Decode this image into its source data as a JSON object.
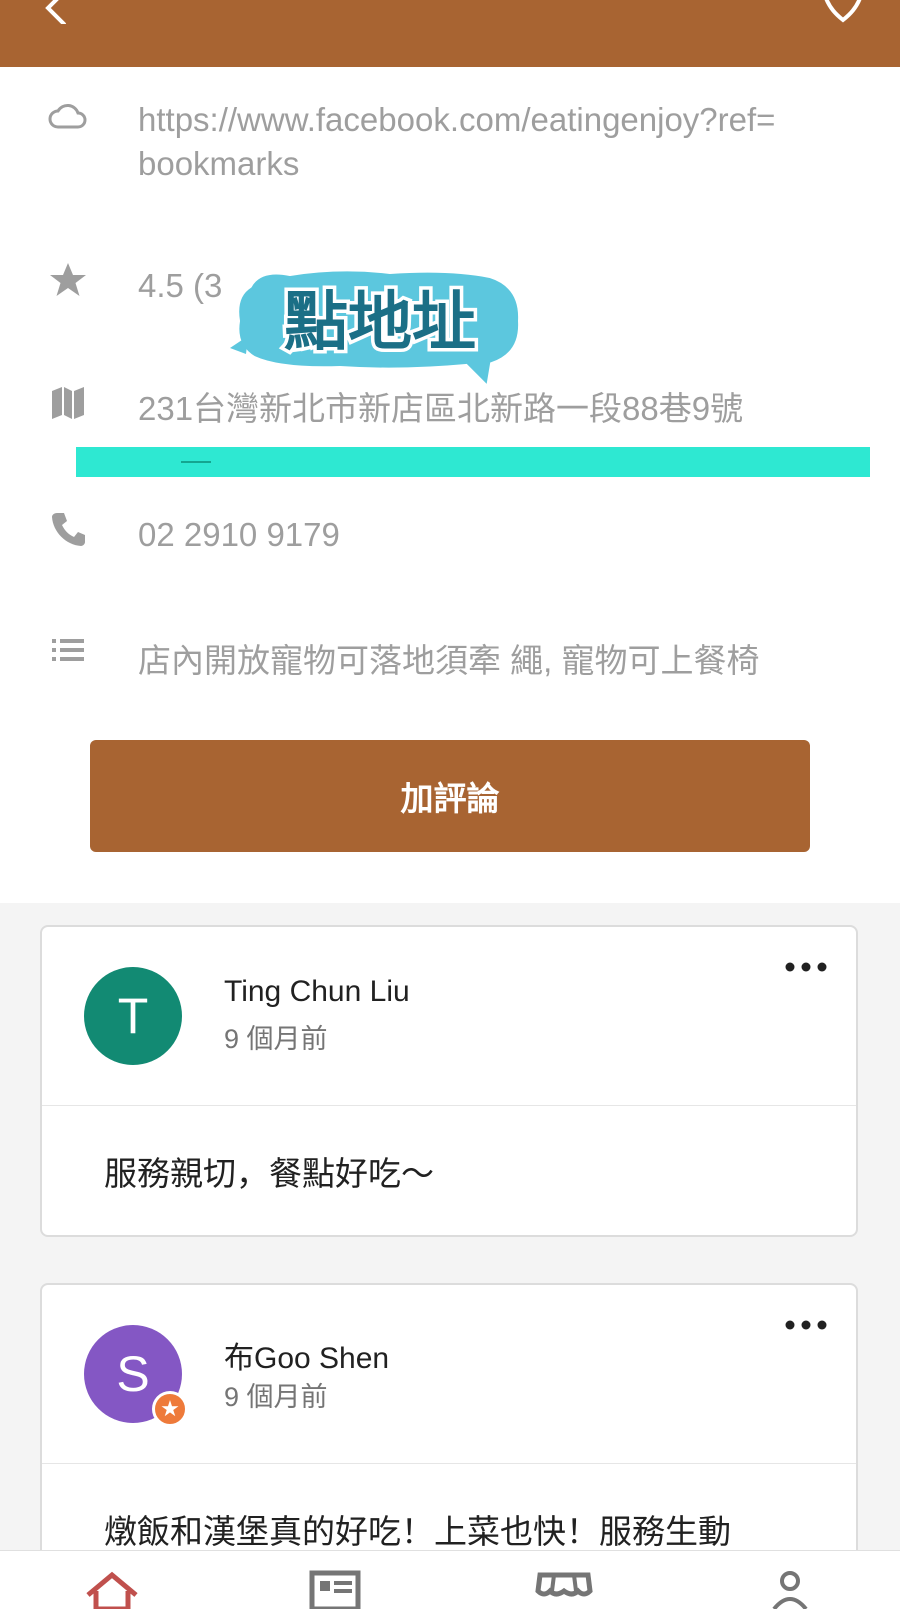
{
  "colors": {
    "brand": "#a86432",
    "highlight": "#2ee8d2",
    "avatar_t": "#128a73",
    "avatar_s": "#8457c4",
    "badge": "#ee7a3a",
    "text_muted": "#9e9e9e"
  },
  "header": {
    "back_icon": "back-arrow-icon",
    "favorite_icon": "heart-outline-icon"
  },
  "info": {
    "website": {
      "icon": "cloud-icon",
      "line1": "https://www.facebook.com/eatingenjoy?ref=",
      "line2": "bookmarks"
    },
    "rating": {
      "icon": "star-icon",
      "text": "4.5 (3"
    },
    "address": {
      "icon": "map-icon",
      "text": "231台灣新北市新店區北新路一段88巷9號"
    },
    "phone": {
      "icon": "phone-icon",
      "text": "02 2910 9179"
    },
    "notes": {
      "icon": "list-icon",
      "text": "店內開放寵物可落地須牽 繩, 寵物可上餐椅"
    }
  },
  "sticker": {
    "text": "點地址"
  },
  "review_button": {
    "label": "加評論"
  },
  "reviews": [
    {
      "avatar_letter": "T",
      "name": "Ting Chun Liu",
      "time": "9 個月前",
      "body": "服務親切，餐點好吃～",
      "local_guide": false
    },
    {
      "avatar_letter": "S",
      "name": "布Goo Shen",
      "time": "9 個月前",
      "body": "燉飯和漢堡真的好吃！上菜也快！服務生動",
      "local_guide": true
    }
  ],
  "bottom_nav": [
    {
      "icon": "home-icon",
      "active": true
    },
    {
      "icon": "news-icon",
      "active": false
    },
    {
      "icon": "store-icon",
      "active": false
    },
    {
      "icon": "profile-icon",
      "active": false
    }
  ]
}
